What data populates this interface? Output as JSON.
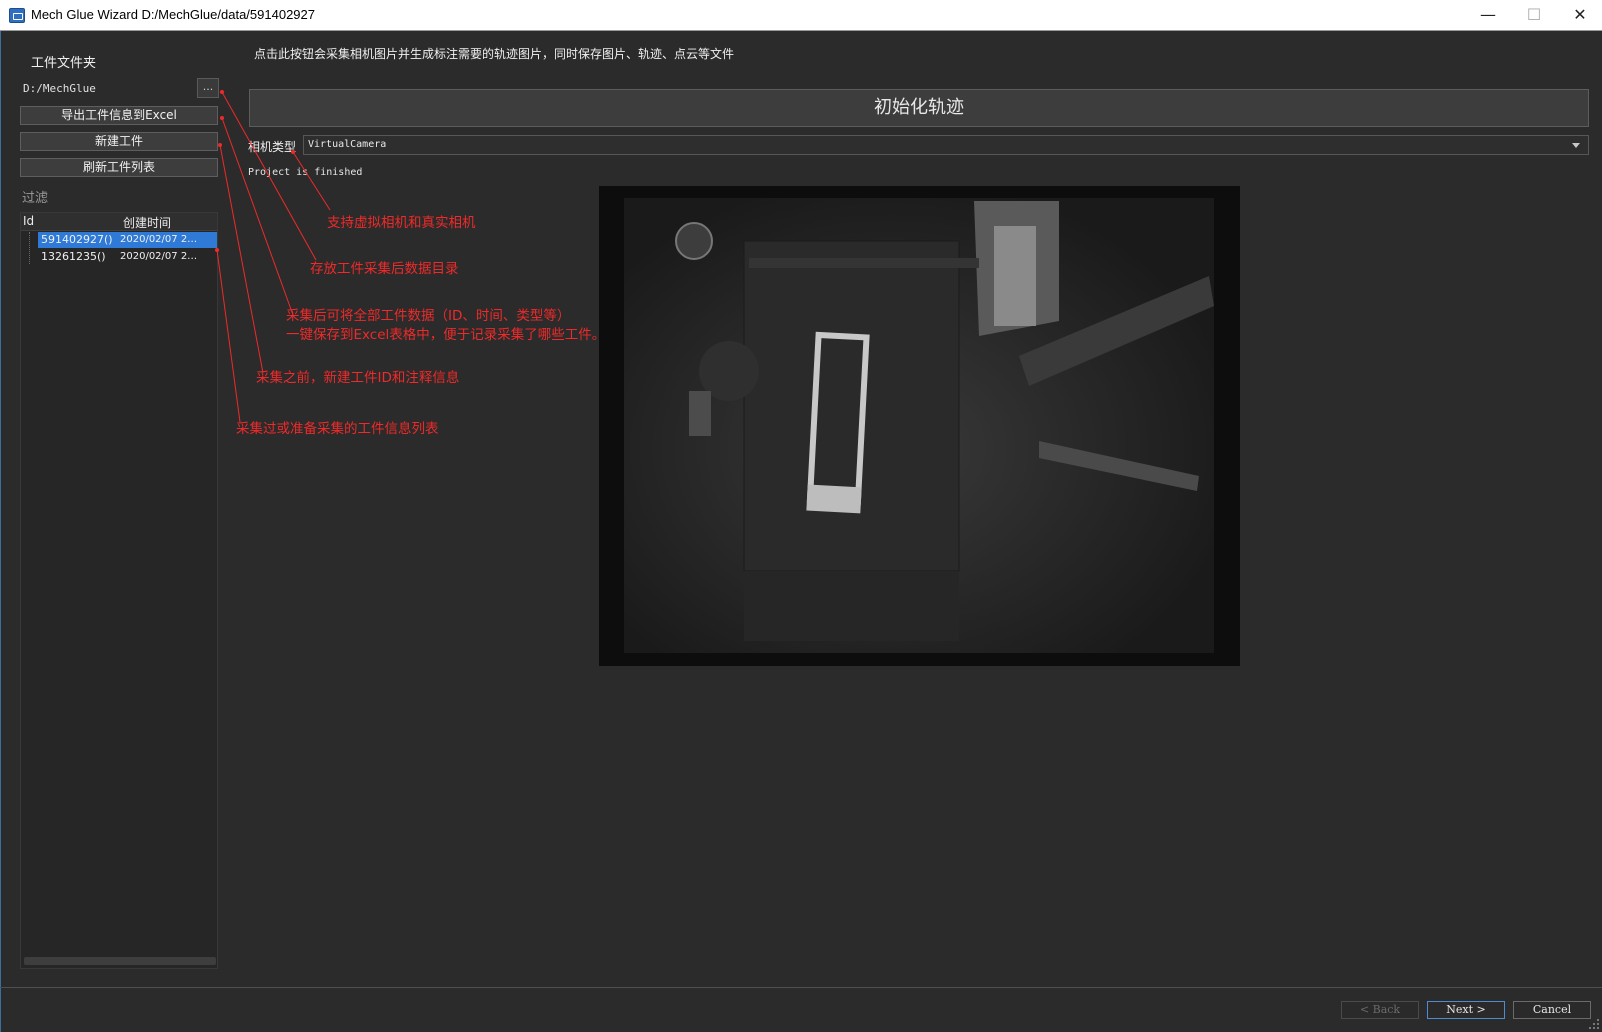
{
  "window": {
    "title": "Mech Glue Wizard D:/MechGlue/data/591402927",
    "controls": [
      "—",
      "☐",
      "✕"
    ]
  },
  "sidebar": {
    "folder_label": "工件文件夹",
    "folder_path": "D:/MechGlue",
    "browse_label": "...",
    "export_button": "导出工件信息到Excel",
    "new_button": "新建工件",
    "refresh_button": "刷新工件列表",
    "filter_label": "过滤",
    "columns": [
      "Id",
      "创建时间"
    ],
    "rows": [
      {
        "id": "591402927()",
        "time": "2020/02/07 2…",
        "selected": true
      },
      {
        "id": "13261235()",
        "time": "2020/02/07 2…",
        "selected": false
      }
    ]
  },
  "main": {
    "hint": "点击此按钮会采集相机图片并生成标注需要的轨迹图片，同时保存图片、轨迹、点云等文件",
    "init_button": "初始化轨迹",
    "camera_label": "相机类型",
    "camera_value": "VirtualCamera",
    "status_text": "Project is finished"
  },
  "annotations": [
    "支持虚拟相机和真实相机",
    "存放工件采集后数据目录",
    "采集后可将全部工件数据（ID、时间、类型等）",
    "一键保存到Excel表格中，便于记录采集了哪些工件。",
    "采集之前，新建工件ID和注释信息",
    "采集过或准备采集的工件信息列表"
  ],
  "footer": {
    "back_label": "< Back",
    "next_label": "Next >",
    "cancel_label": "Cancel"
  },
  "colors": {
    "background": "#2b2b2b",
    "selection": "#2f7ad6",
    "annotation": "#ee2a2a"
  }
}
